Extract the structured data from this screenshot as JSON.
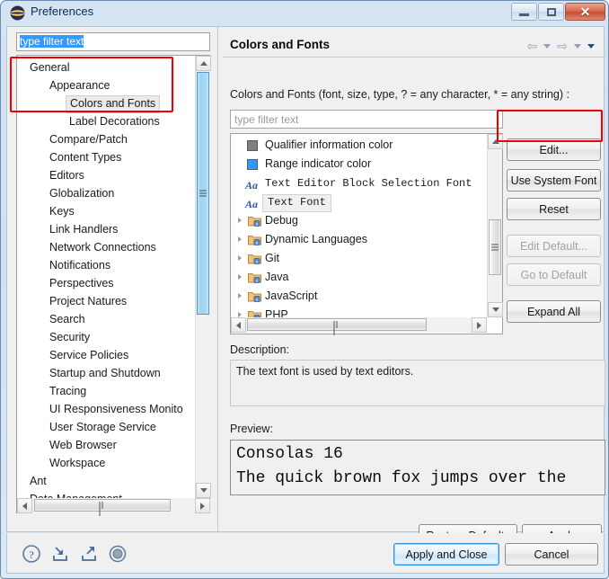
{
  "window": {
    "title": "Preferences",
    "icon": "eclipse-logo-icon",
    "minimize_label": "",
    "restore_label": "",
    "close_label": "✕"
  },
  "sidebar": {
    "filter_value": "type filter text",
    "items": [
      {
        "label": "General",
        "indent": 0,
        "arrow": "open"
      },
      {
        "label": "Appearance",
        "indent": 1,
        "arrow": "open"
      },
      {
        "label": "Colors and Fonts",
        "indent": 2,
        "arrow": "none",
        "selected": true
      },
      {
        "label": "Label Decorations",
        "indent": 2,
        "arrow": "none"
      },
      {
        "label": "Compare/Patch",
        "indent": 1,
        "arrow": "none"
      },
      {
        "label": "Content Types",
        "indent": 1,
        "arrow": "none"
      },
      {
        "label": "Editors",
        "indent": 1,
        "arrow": "closed"
      },
      {
        "label": "Globalization",
        "indent": 1,
        "arrow": "none"
      },
      {
        "label": "Keys",
        "indent": 1,
        "arrow": "none"
      },
      {
        "label": "Link Handlers",
        "indent": 1,
        "arrow": "none"
      },
      {
        "label": "Network Connections",
        "indent": 1,
        "arrow": "closed"
      },
      {
        "label": "Notifications",
        "indent": 1,
        "arrow": "none"
      },
      {
        "label": "Perspectives",
        "indent": 1,
        "arrow": "none"
      },
      {
        "label": "Project Natures",
        "indent": 1,
        "arrow": "none"
      },
      {
        "label": "Search",
        "indent": 1,
        "arrow": "none"
      },
      {
        "label": "Security",
        "indent": 1,
        "arrow": "closed"
      },
      {
        "label": "Service Policies",
        "indent": 1,
        "arrow": "none"
      },
      {
        "label": "Startup and Shutdown",
        "indent": 1,
        "arrow": "closed"
      },
      {
        "label": "Tracing",
        "indent": 1,
        "arrow": "none"
      },
      {
        "label": "UI Responsiveness Monito",
        "indent": 1,
        "arrow": "none"
      },
      {
        "label": "User Storage Service",
        "indent": 1,
        "arrow": "closed"
      },
      {
        "label": "Web Browser",
        "indent": 1,
        "arrow": "none"
      },
      {
        "label": "Workspace",
        "indent": 1,
        "arrow": "closed"
      },
      {
        "label": "Ant",
        "indent": 0,
        "arrow": "closed"
      },
      {
        "label": "Data Management",
        "indent": 0,
        "arrow": "closed"
      }
    ]
  },
  "page": {
    "title": "Colors and Fonts",
    "nav_back_icon": "arrow-left-icon",
    "nav_back_caret_icon": "chevron-down-icon",
    "nav_forward_icon": "arrow-right-icon",
    "nav_forward_caret_icon": "chevron-down-icon",
    "nav_menu_caret_icon": "chevron-down-icon",
    "instruction": "Colors and Fonts (font, size, type, ? = any character, * = any string) :",
    "filter_placeholder": "type filter text",
    "tree": [
      {
        "label": "Qualifier information color",
        "icon": "color-swatch",
        "color": "#808080",
        "mono": false,
        "expandable": false,
        "selected": false
      },
      {
        "label": "Range indicator color",
        "icon": "color-swatch",
        "color": "#2e9afe",
        "mono": false,
        "expandable": false,
        "selected": false
      },
      {
        "label": "Text Editor Block Selection Font",
        "icon": "font-aa-icon",
        "mono": true,
        "expandable": false,
        "selected": false
      },
      {
        "label": "Text Font",
        "icon": "font-aa-icon",
        "mono": true,
        "expandable": false,
        "selected": true
      },
      {
        "label": "Debug",
        "icon": "folder-icon",
        "mono": false,
        "expandable": true,
        "selected": false
      },
      {
        "label": "Dynamic Languages",
        "icon": "folder-icon",
        "mono": false,
        "expandable": true,
        "selected": false
      },
      {
        "label": "Git",
        "icon": "folder-icon",
        "mono": false,
        "expandable": true,
        "selected": false
      },
      {
        "label": "Java",
        "icon": "folder-icon",
        "mono": false,
        "expandable": true,
        "selected": false
      },
      {
        "label": "JavaScript",
        "icon": "folder-icon",
        "mono": false,
        "expandable": true,
        "selected": false
      },
      {
        "label": "PHP",
        "icon": "folder-icon",
        "mono": false,
        "expandable": true,
        "selected": false
      }
    ],
    "buttons": {
      "edit": {
        "label": "Edit...",
        "underline": "E",
        "enabled": true,
        "highlighted": true
      },
      "use_system_font": {
        "label": "Use System Font",
        "underline": "U",
        "enabled": true
      },
      "reset": {
        "label": "Reset",
        "underline": "R",
        "enabled": true
      },
      "edit_default": {
        "label": "Edit Default...",
        "underline": "i",
        "enabled": false
      },
      "go_to_default": {
        "label": "Go to Default",
        "underline": "G",
        "enabled": false
      },
      "expand_all": {
        "label": "Expand All",
        "underline": "x",
        "enabled": true
      }
    },
    "description_label": "Description:",
    "description_text": "The text font is used by text editors.",
    "preview_label": "Preview:",
    "preview_line1": "Consolas 16",
    "preview_line2": "The quick brown fox jumps over the",
    "restore_defaults_label": "Restore Defaults",
    "apply_label": "Apply"
  },
  "footer": {
    "help_icon": "help-question-icon",
    "import_icon": "import-arrow-icon",
    "export_icon": "export-arrow-icon",
    "record_icon": "record-circle-icon",
    "apply_and_close_label": "Apply and Close",
    "cancel_label": "Cancel"
  },
  "annotations": {
    "highlight_color": "#f00000",
    "box_sidebar_selection": "General / Appearance / Colors and Fonts",
    "box_edit_button": "Edit..."
  }
}
